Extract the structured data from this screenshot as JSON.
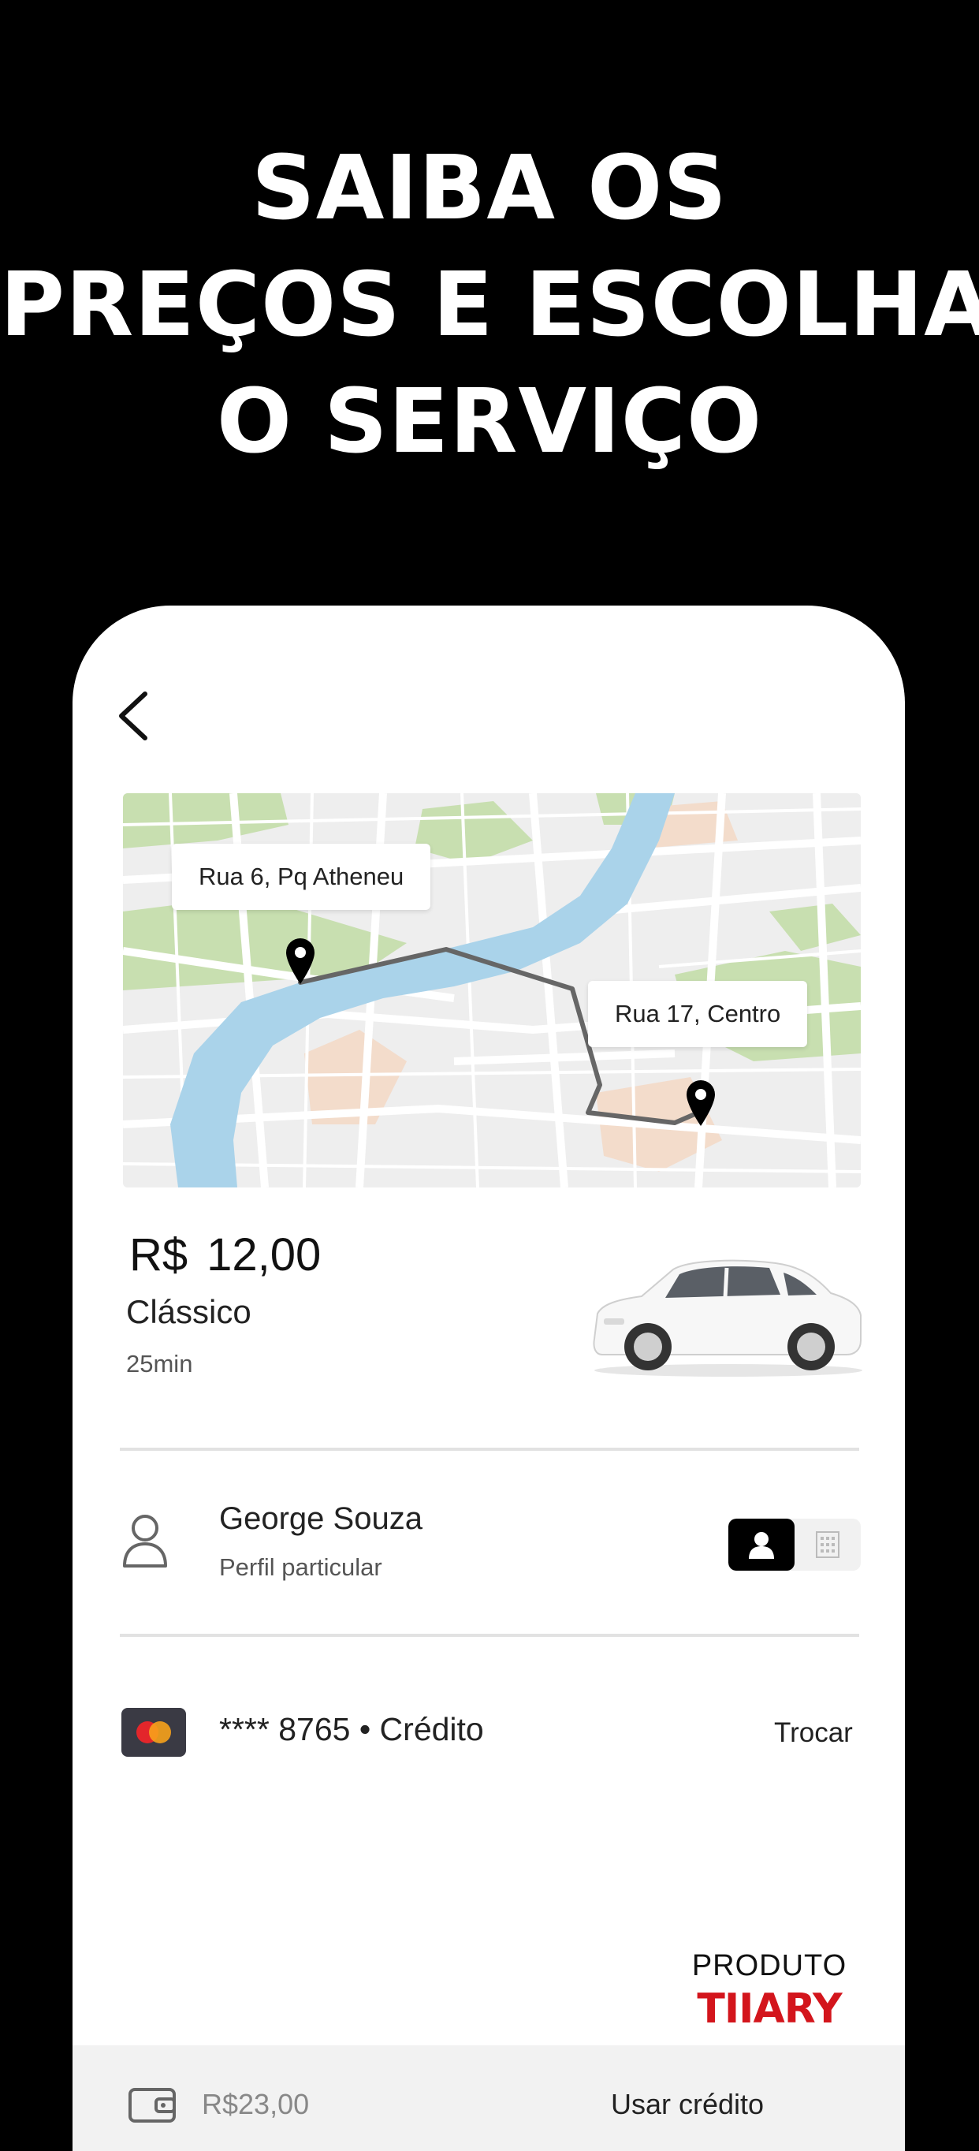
{
  "headline": {
    "line1": "SAIBA OS",
    "line2": "PREÇOS E ESCOLHA",
    "line3": "O SERVIÇO"
  },
  "map": {
    "origin_label": "Rua 6, Pq Atheneu",
    "destination_label": "Rua 17, Centro"
  },
  "ride": {
    "currency": "R$",
    "price": "12,00",
    "service": "Clássico",
    "duration": "25min"
  },
  "user": {
    "name": "George Souza",
    "profile": "Perfil particular"
  },
  "payment": {
    "card": "**** 8765 • Crédito",
    "change_label": "Trocar"
  },
  "badge": {
    "top": "PRODUTO",
    "bottom": "TIIARY"
  },
  "bottom_bar": {
    "balance": "R$23,00",
    "use_credit_label": "Usar crédito"
  },
  "colors": {
    "background": "#000000",
    "river": "#aad3ea",
    "park": "#c8dfb0",
    "route": "#666666",
    "brand_red": "#d3151c"
  },
  "icons": {
    "back": "chevron-left-icon",
    "pin": "map-pin-icon",
    "user": "user-outline-icon",
    "personal": "person-icon",
    "business": "building-icon",
    "card": "mastercard-icon",
    "wallet": "wallet-icon"
  }
}
